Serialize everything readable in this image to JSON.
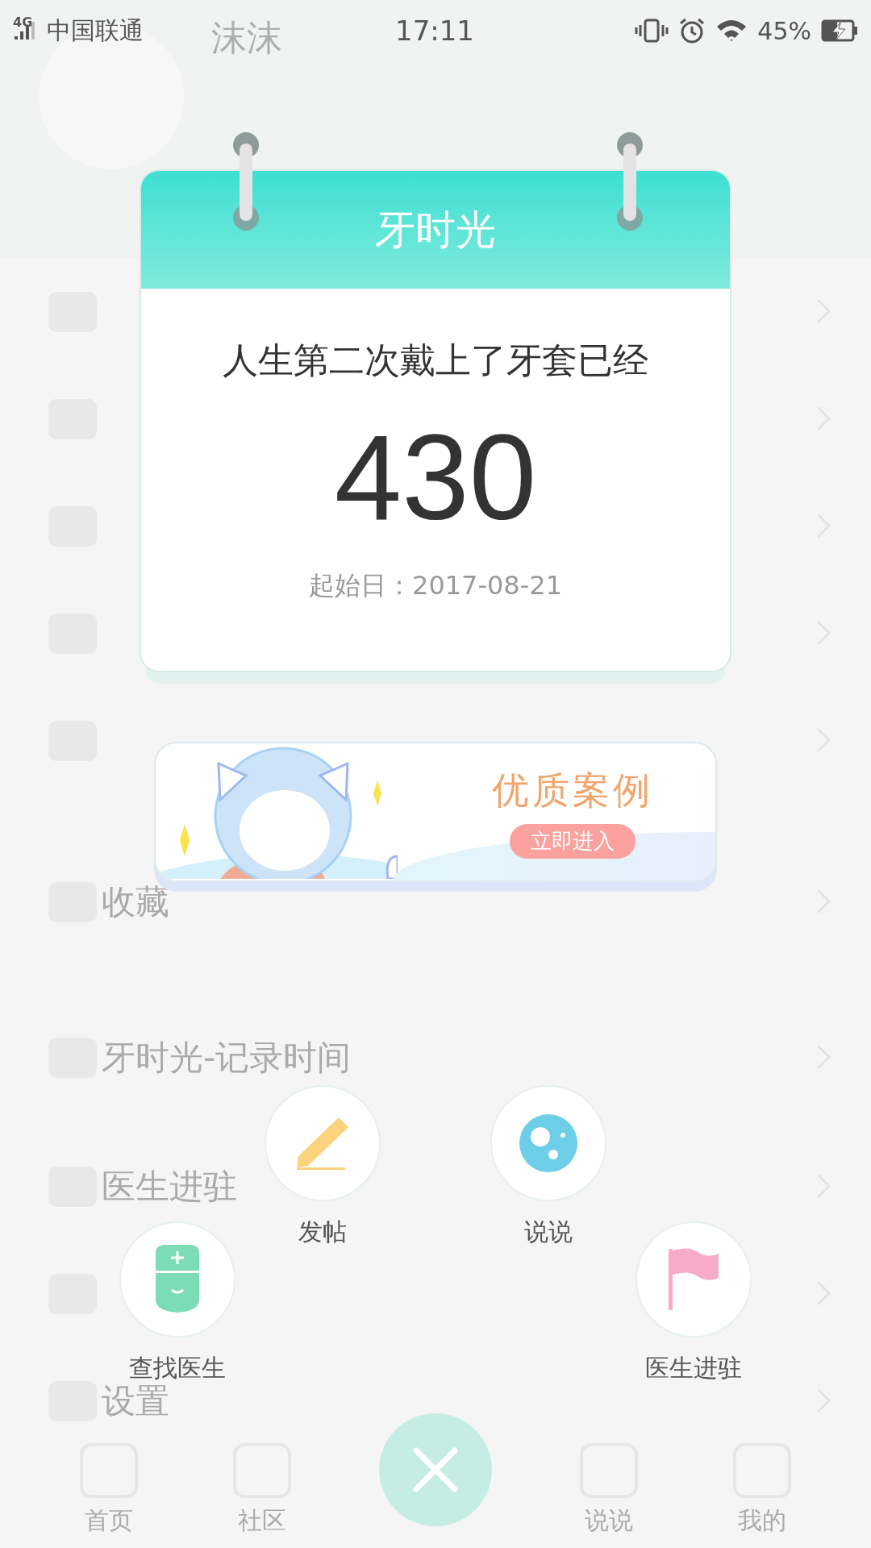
{
  "status_bar": {
    "network": "4G",
    "carrier": "中国联通",
    "time": "17:11",
    "battery": "45%"
  },
  "profile": {
    "name": "沫沫"
  },
  "menu": [
    {
      "label": "收藏"
    },
    {
      "label": "牙时光-记录时间"
    },
    {
      "label": "医生进驻"
    },
    {
      "label": "设置"
    }
  ],
  "nav": [
    {
      "label": "首页"
    },
    {
      "label": "社区"
    },
    {
      "label": "说说"
    },
    {
      "label": "我的"
    }
  ],
  "calendar": {
    "title": "牙时光",
    "caption": "人生第二次戴上了牙套已经",
    "days": "430",
    "start": "起始日：2017-08-21"
  },
  "banner": {
    "title": "优质案例",
    "button": "立即进入"
  },
  "actions": [
    {
      "label": "发帖"
    },
    {
      "label": "说说"
    },
    {
      "label": "查找医生"
    },
    {
      "label": "医生进驻"
    }
  ]
}
